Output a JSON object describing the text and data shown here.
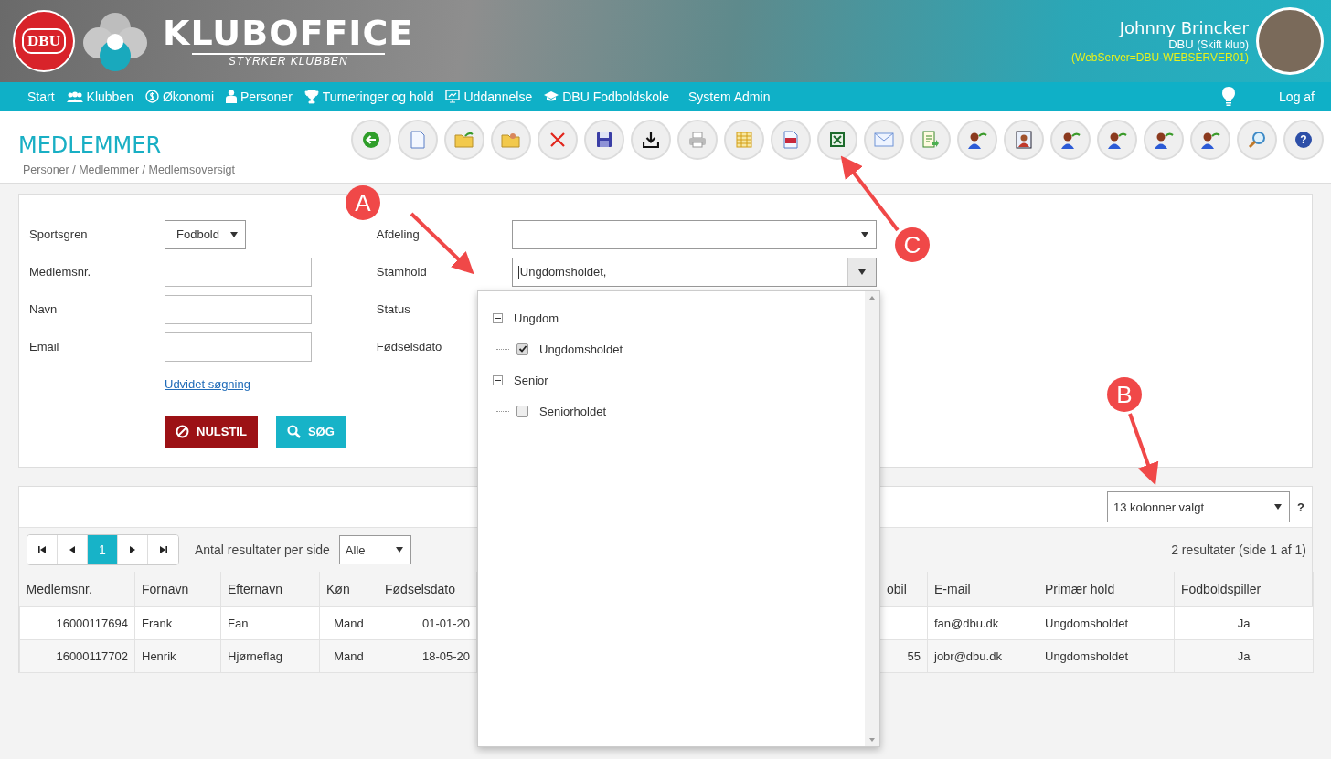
{
  "header": {
    "dbu_logo": "DBU",
    "app_name": "KLUBOFFICE",
    "tagline": "STYRKER KLUBBEN",
    "user": {
      "name": "Johnny Brincker",
      "club": "DBU",
      "switch_club": "(Skift klub)",
      "server": "(WebServer=DBU-WEBSERVER01)"
    }
  },
  "nav": {
    "items": [
      {
        "label": "Start"
      },
      {
        "label": "Klubben"
      },
      {
        "label": "Økonomi"
      },
      {
        "label": "Personer"
      },
      {
        "label": "Turneringer og hold"
      },
      {
        "label": "Uddannelse"
      },
      {
        "label": "DBU Fodboldskole"
      },
      {
        "label": "System Admin"
      }
    ],
    "logout": "Log af"
  },
  "page": {
    "title": "MEDLEMMER",
    "breadcrumb": "Personer / Medlemmer / Medlemsoversigt"
  },
  "toolbar": {
    "help_glyph": "?"
  },
  "search_form": {
    "fields": [
      {
        "label": "Sportsgren",
        "kind": "select",
        "value": "Fodbold"
      },
      {
        "label": "Medlemsnr.",
        "kind": "input"
      },
      {
        "label": "Navn",
        "kind": "input"
      },
      {
        "label": "Email",
        "kind": "input"
      }
    ],
    "extra_fields": [
      {
        "label": "Afdeling",
        "kind": "select",
        "focused": false
      },
      {
        "label": "Stamhold",
        "kind": "select",
        "value": "Ungdomsholdet,",
        "focused": true
      },
      {
        "label": "Status",
        "kind": "hidden"
      },
      {
        "label": "Fødselsdato",
        "kind": "hidden"
      }
    ],
    "advanced_link": "Udvidet søgning",
    "reset_button": "NULSTIL",
    "search_button": "SØG"
  },
  "stamhold_dropdown": {
    "tree": [
      {
        "label": "Ungdom",
        "expanded": true,
        "children": [
          {
            "label": "Ungdomsholdet",
            "checked": true
          }
        ]
      },
      {
        "label": "Senior",
        "expanded": true,
        "children": [
          {
            "label": "Seniorholdet",
            "checked": false
          }
        ]
      }
    ]
  },
  "results": {
    "column_selector": "13 kolonner valgt",
    "help": "?",
    "pager": {
      "pages": [
        {
          "label": "1",
          "selected": true
        }
      ],
      "per_page_label": "Antal resultater per side",
      "per_page_value": "Alle"
    },
    "summary": "2 resultater (side 1 af 1)",
    "table": {
      "columns": [
        "Medlemsnr.",
        "Fornavn",
        "Efternavn",
        "Køn",
        "Fødselsdato",
        "obil",
        "E-mail",
        "Primær hold",
        "Fodboldspiller"
      ],
      "rows": [
        [
          "16000117694",
          "Frank",
          "Fan",
          "Mand",
          "01-01-20",
          null,
          "fan@dbu.dk",
          "Ungdomsholdet",
          "Ja"
        ],
        [
          "16000117702",
          "Henrik",
          "Hjørneflag",
          "Mand",
          "18-05-20",
          "55",
          "jobr@dbu.dk",
          "Ungdomsholdet",
          "Ja"
        ]
      ]
    }
  },
  "annotations": [
    {
      "label": "A"
    },
    {
      "label": "B"
    },
    {
      "label": "C"
    }
  ]
}
